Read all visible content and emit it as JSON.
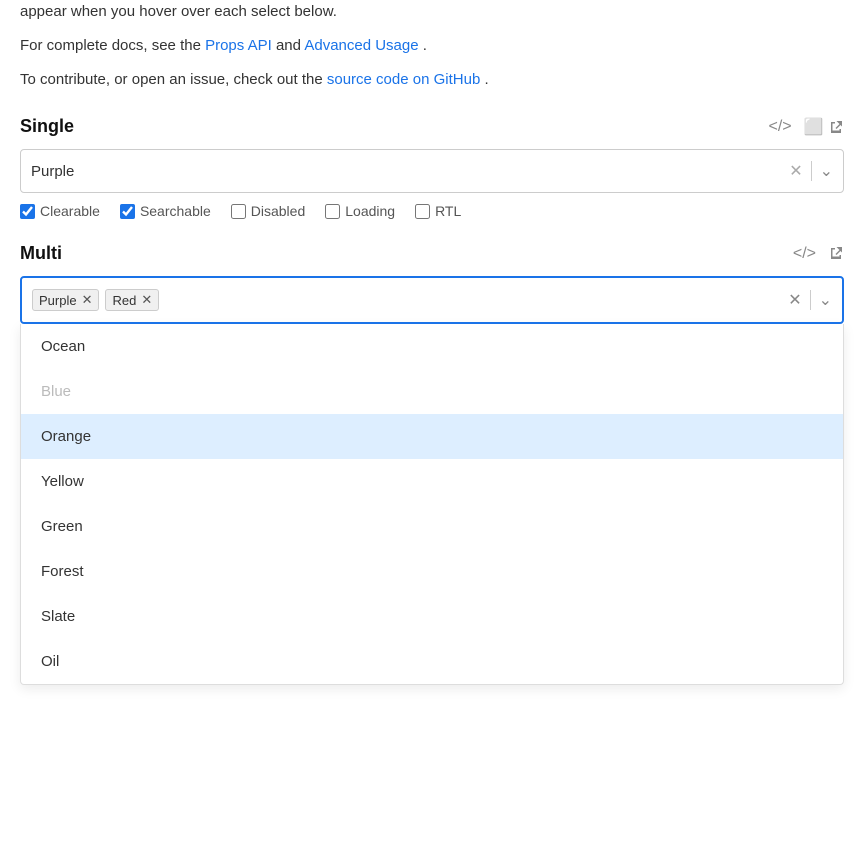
{
  "intro": {
    "line1": "appear when you hover over each select below.",
    "line2_prefix": "For complete docs, see the ",
    "props_api_label": "Props API",
    "props_api_href": "#",
    "line2_mid": " and ",
    "advanced_usage_label": "Advanced Usage",
    "advanced_usage_href": "#",
    "line2_suffix": ".",
    "line3_prefix": "To contribute, or open an issue, check out the ",
    "github_label": "source code on GitHub",
    "github_href": "#",
    "line3_suffix": "."
  },
  "single_section": {
    "title": "Single",
    "code_icon": "</>",
    "external_icon": "⬡",
    "selected_value": "Purple",
    "options": {
      "clearable": {
        "label": "Clearable",
        "checked": true
      },
      "searchable": {
        "label": "Searchable",
        "checked": true
      },
      "disabled": {
        "label": "Disabled",
        "checked": false
      },
      "loading": {
        "label": "Loading",
        "checked": false
      },
      "rtl": {
        "label": "RTL",
        "checked": false
      }
    }
  },
  "multi_section": {
    "title": "Multi",
    "code_icon": "</>",
    "external_icon": "⬡",
    "selected_tags": [
      {
        "label": "Purple"
      },
      {
        "label": "Red"
      }
    ],
    "dropdown_items": [
      {
        "label": "Ocean",
        "disabled": false,
        "highlighted": false
      },
      {
        "label": "Blue",
        "disabled": true,
        "highlighted": false
      },
      {
        "label": "Orange",
        "disabled": false,
        "highlighted": true
      },
      {
        "label": "Yellow",
        "disabled": false,
        "highlighted": false
      },
      {
        "label": "Green",
        "disabled": false,
        "highlighted": false
      },
      {
        "label": "Forest",
        "disabled": false,
        "highlighted": false
      },
      {
        "label": "Slate",
        "disabled": false,
        "highlighted": false
      },
      {
        "label": "Oil",
        "disabled": false,
        "highlighted": false
      }
    ]
  }
}
